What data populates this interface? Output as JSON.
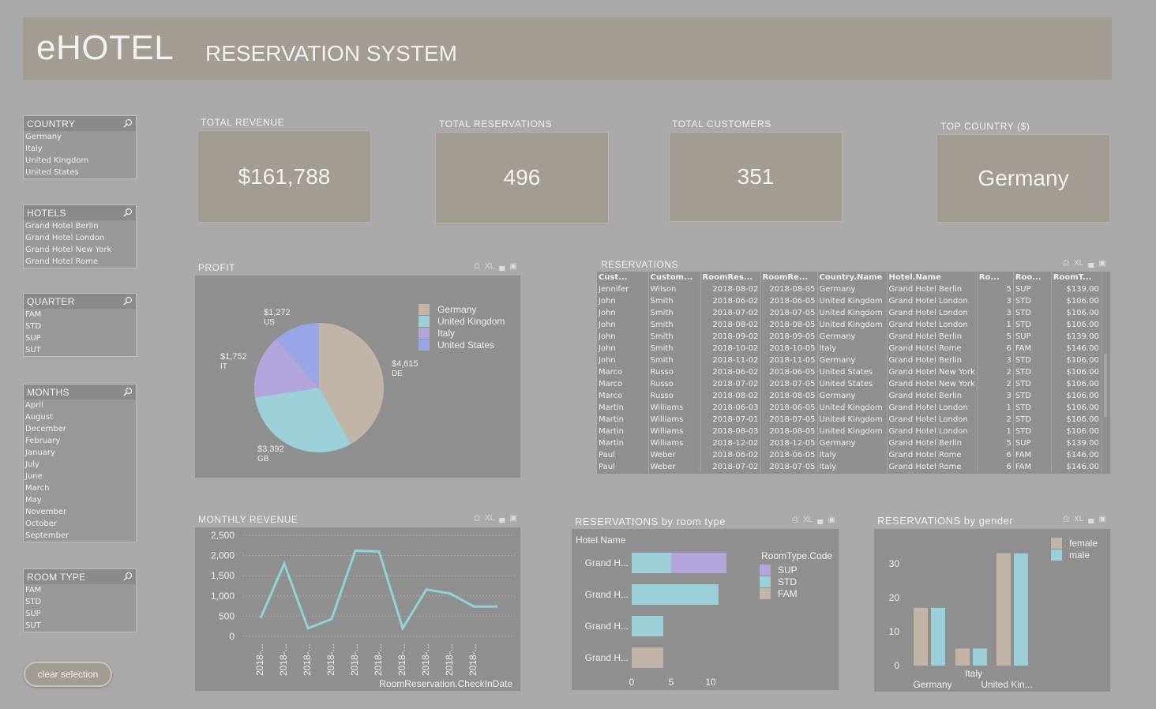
{
  "header": {
    "logo": "eHOTEL",
    "subtitle": "RESERVATION SYSTEM"
  },
  "filters": {
    "country": {
      "title": "COUNTRY",
      "items": [
        "Germany",
        "Italy",
        "United Kingdom",
        "United States"
      ]
    },
    "hotels": {
      "title": "HOTELS",
      "items": [
        "Grand Hotel Berlin",
        "Grand Hotel London",
        "Grand Hotel New York",
        "Grand Hotel Rome"
      ]
    },
    "quarter": {
      "title": "QUARTER",
      "items": [
        "FAM",
        "STD",
        "SUP",
        "SUT"
      ]
    },
    "months": {
      "title": "MONTHS",
      "items": [
        "April",
        "August",
        "December",
        "February",
        "January",
        "July",
        "June",
        "March",
        "May",
        "November",
        "October",
        "September"
      ]
    },
    "room_type": {
      "title": "ROOM TYPE",
      "items": [
        "FAM",
        "STD",
        "SUP",
        "SUT"
      ]
    },
    "clear_label": "clear selection"
  },
  "kpis": {
    "revenue": {
      "label": "TOTAL  REVENUE",
      "value": "$161,788"
    },
    "reservations": {
      "label": "TOTAL  RESERVATIONS",
      "value": "496"
    },
    "customers": {
      "label": "TOTAL  CUSTOMERS",
      "value": "351"
    },
    "top_country": {
      "label": "TOP  COUNTRY  ($)",
      "value": "Germany"
    }
  },
  "panel_controls": {
    "xl": "XL"
  },
  "profit": {
    "title": "PROFIT",
    "legend": [
      "Germany",
      "United Kingdom",
      "Italy",
      "United States"
    ],
    "labels": {
      "de_value": "$4,615",
      "de_code": "DE",
      "gb_value": "$3,392",
      "gb_code": "GB",
      "it_value": "$1,752",
      "it_code": "IT",
      "us_value": "$1,272",
      "us_code": "US"
    }
  },
  "reservations": {
    "title": "RESERVATIONS",
    "columns": [
      "Cust...",
      "Custom...",
      "RoomRes...",
      "RoomRe...",
      "Country.Name",
      "Hotel.Name",
      "Ro...",
      "Roo...",
      "RoomT..."
    ],
    "rows": [
      [
        "Jennifer",
        "Wilson",
        "2018-08-02",
        "2018-08-05",
        "Germany",
        "Grand Hotel Berlin",
        "5",
        "SUP",
        "$139.00"
      ],
      [
        "John",
        "Smith",
        "2018-06-02",
        "2018-06-05",
        "United Kingdom",
        "Grand Hotel London",
        "3",
        "STD",
        "$106.00"
      ],
      [
        "John",
        "Smith",
        "2018-07-02",
        "2018-07-05",
        "United Kingdom",
        "Grand Hotel London",
        "3",
        "STD",
        "$106.00"
      ],
      [
        "John",
        "Smith",
        "2018-08-02",
        "2018-08-05",
        "United Kingdom",
        "Grand Hotel London",
        "1",
        "STD",
        "$106.00"
      ],
      [
        "John",
        "Smith",
        "2018-09-02",
        "2018-09-05",
        "Germany",
        "Grand Hotel Berlin",
        "5",
        "SUP",
        "$139.00"
      ],
      [
        "John",
        "Smith",
        "2018-10-02",
        "2018-10-05",
        "Italy",
        "Grand Hotel Rome",
        "6",
        "FAM",
        "$146.00"
      ],
      [
        "John",
        "Smith",
        "2018-11-02",
        "2018-11-05",
        "Germany",
        "Grand Hotel Berlin",
        "3",
        "STD",
        "$106.00"
      ],
      [
        "Marco",
        "Russo",
        "2018-06-02",
        "2018-06-05",
        "United States",
        "Grand Hotel New York",
        "2",
        "STD",
        "$106.00"
      ],
      [
        "Marco",
        "Russo",
        "2018-07-02",
        "2018-07-05",
        "United States",
        "Grand Hotel New York",
        "2",
        "STD",
        "$106.00"
      ],
      [
        "Marco",
        "Russo",
        "2018-08-02",
        "2018-08-05",
        "Germany",
        "Grand Hotel Berlin",
        "3",
        "STD",
        "$106.00"
      ],
      [
        "Martin",
        "Williams",
        "2018-06-03",
        "2018-06-05",
        "United Kingdom",
        "Grand Hotel London",
        "1",
        "STD",
        "$106.00"
      ],
      [
        "Martin",
        "Williams",
        "2018-07-01",
        "2018-07-05",
        "United Kingdom",
        "Grand Hotel London",
        "2",
        "STD",
        "$106.00"
      ],
      [
        "Martin",
        "Williams",
        "2018-08-03",
        "2018-08-05",
        "United Kingdom",
        "Grand Hotel London",
        "1",
        "STD",
        "$106.00"
      ],
      [
        "Martin",
        "Williams",
        "2018-12-02",
        "2018-12-05",
        "Germany",
        "Grand Hotel Berlin",
        "5",
        "SUP",
        "$139.00"
      ],
      [
        "Paul",
        "Weber",
        "2018-06-02",
        "2018-06-05",
        "Italy",
        "Grand Hotel Rome",
        "6",
        "FAM",
        "$146.00"
      ],
      [
        "Paul",
        "Weber",
        "2018-07-02",
        "2018-07-05",
        "Italy",
        "Grand Hotel Rome",
        "6",
        "FAM",
        "$146.00"
      ]
    ]
  },
  "monthly_revenue": {
    "title": "MONTHLY  REVENUE",
    "xlabel": "RoomReservation.CheckInDate",
    "tick_label": "2018-..."
  },
  "room_type_chart": {
    "title": "RESERVATIONS by room type",
    "ylabel": "Hotel.Name",
    "legend_title": "RoomType.Code",
    "category_label": "Grand H..."
  },
  "gender_chart": {
    "title": "RESERVATIONS by gender"
  },
  "colors": {
    "germany": "#c2b5a8",
    "uk": "#9bd0d8",
    "italy": "#b3a4db",
    "us": "#98a5e6",
    "line": "#8fd3d9",
    "sup": "#b3a4db",
    "std": "#9bd0d8",
    "fam": "#c2b5a8",
    "female": "#c2b5a8",
    "male": "#9bd0d8"
  },
  "chart_data": [
    {
      "type": "pie",
      "title": "PROFIT",
      "categories": [
        "Germany",
        "United Kingdom",
        "Italy",
        "United States"
      ],
      "values": [
        4615,
        3392,
        1752,
        1272
      ]
    },
    {
      "type": "line",
      "title": "MONTHLY  REVENUE",
      "xlabel": "RoomReservation.CheckInDate",
      "ylabel": "",
      "ylim": [
        0,
        2500
      ],
      "yticks": [
        0,
        500,
        1000,
        1500,
        2000,
        2500
      ],
      "x": [
        "2018-...",
        "2018-...",
        "2018-...",
        "2018-...",
        "2018-...",
        "2018-...",
        "2018-...",
        "2018-...",
        "2018-...",
        "2018-..."
      ],
      "values": [
        450,
        1800,
        200,
        430,
        2120,
        2100,
        200,
        1160,
        1060,
        740,
        740
      ],
      "grid": true
    },
    {
      "type": "bar",
      "title": "RESERVATIONS by room type",
      "orientation": "horizontal",
      "stacked": true,
      "ylabel": "Hotel.Name",
      "categories": [
        "Grand H...",
        "Grand H...",
        "Grand H...",
        "Grand H..."
      ],
      "series": [
        {
          "name": "FAM",
          "values": [
            0,
            0,
            0,
            4
          ]
        },
        {
          "name": "STD",
          "values": [
            5,
            11,
            4,
            0
          ]
        },
        {
          "name": "SUP",
          "values": [
            7,
            0,
            0,
            0
          ]
        }
      ],
      "xticks": [
        0,
        5,
        10
      ],
      "xlim": [
        0,
        12
      ]
    },
    {
      "type": "bar",
      "title": "RESERVATIONS by gender",
      "categories": [
        "Germany",
        "Italy",
        "United Kin..."
      ],
      "series": [
        {
          "name": "female",
          "values": [
            17,
            5,
            33
          ]
        },
        {
          "name": "male",
          "values": [
            17,
            5,
            33
          ]
        }
      ],
      "yticks": [
        0,
        10,
        20,
        30
      ],
      "ylim": [
        0,
        36
      ]
    }
  ]
}
